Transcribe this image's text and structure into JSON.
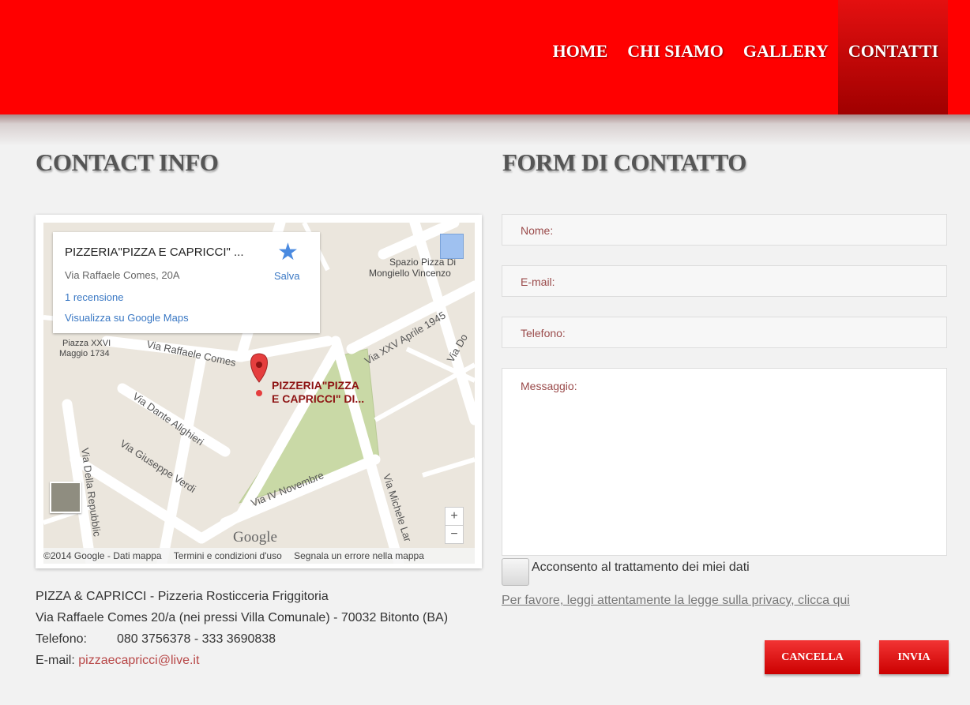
{
  "nav": {
    "items": [
      {
        "label": "HOME"
      },
      {
        "label": "CHI SIAMO"
      },
      {
        "label": "GALLERY"
      },
      {
        "label": "CONTATTI",
        "active": true
      }
    ]
  },
  "left": {
    "title": "CONTACT INFO",
    "map": {
      "infowindow": {
        "title": "PIZZERIA\"PIZZA E CAPRICCI\" ...",
        "address": "Via Raffaele Comes, 20A",
        "reviews": "1 recensione",
        "view_link": "Visualizza su Google Maps",
        "save_label": "Salva"
      },
      "marker_label_line1": "PIZZERIA\"PIZZA",
      "marker_label_line2": "E CAPRICCI\" DI...",
      "place_label_line1": "Spazio Pizza Di",
      "place_label_line2": "Mongiello Vincenzo",
      "piazza_line1": "Piazza XXVI",
      "piazza_line2": "Maggio 1734",
      "streets": {
        "raffaele_comes": "Via Raffaele Comes",
        "dante": "Via Dante Alighieri",
        "verdi": "Via Giuseppe Verdi",
        "iv_novembre": "Via IV Novembre",
        "michele": "Via Michele Lar",
        "repubblica": "Via Della Repubblic",
        "xxv_aprile": "Via XXV Aprile 1945",
        "via_do": "Via Do"
      },
      "google_logo": "Google",
      "zoom_in": "+",
      "zoom_out": "−",
      "footer": {
        "copyright": "©2014 Google - Dati mappa",
        "terms": "Termini e condizioni d'uso",
        "report": "Segnala un errore nella mappa"
      }
    },
    "contact": {
      "line1": "PIZZA & CAPRICCI - Pizzeria Rosticceria Friggitoria",
      "line2": "Via Raffaele Comes 20/a (nei pressi Villa Comunale) - 70032 Bitonto (BA)",
      "phone_label": "Telefono:",
      "phone_value": "080 3756378 - 333 3690838",
      "email_label": "E-mail:",
      "email_value": "pizzaecapricci@live.it"
    }
  },
  "right": {
    "title": "FORM DI CONTATTO",
    "fields": {
      "name": "Nome:",
      "email": "E-mail:",
      "phone": "Telefono:",
      "message": "Messaggio:"
    },
    "consent": "Acconsento al trattamento dei  miei dati",
    "privacy": "Per favore, leggi attentamente la legge sulla privacy, clicca qui",
    "cancel": "CANCELLA",
    "send": "INVIA"
  },
  "colors": {
    "header": "#ff0000",
    "accent": "#cc0000",
    "email": "#b84848"
  }
}
